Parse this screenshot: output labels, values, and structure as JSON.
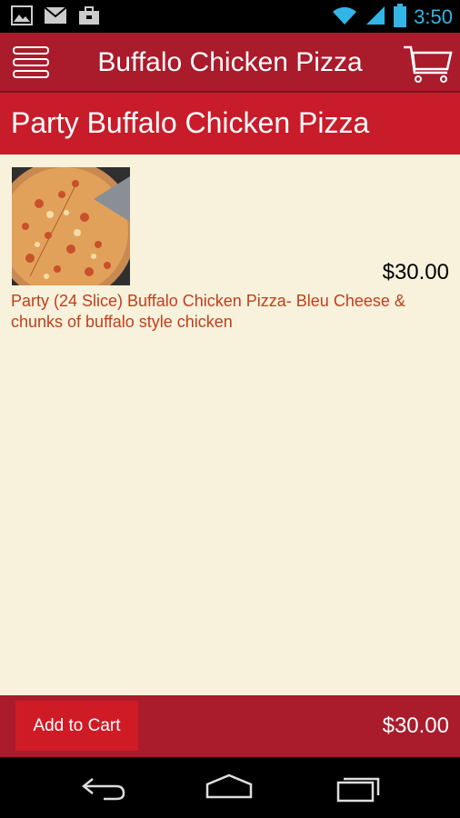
{
  "status_bar": {
    "time": "3:50",
    "icons": [
      "image-icon",
      "gmail-icon",
      "briefcase-icon",
      "wifi-icon",
      "signal-icon",
      "battery-icon"
    ]
  },
  "app_bar": {
    "title": "Buffalo Chicken Pizza",
    "menu_icon": "menu-icon",
    "cart_icon": "cart-icon"
  },
  "section": {
    "title": "Party Buffalo Chicken Pizza"
  },
  "item": {
    "price": "$30.00",
    "description": "Party (24 Slice) Buffalo Chicken Pizza- Bleu Cheese & chunks of buffalo style chicken",
    "image": "pizza-photo"
  },
  "bottom_bar": {
    "add_to_cart_label": "Add to Cart",
    "total": "$30.00"
  },
  "nav_bar": {
    "icons": [
      "back-icon",
      "home-icon",
      "recents-icon"
    ]
  },
  "colors": {
    "app_bar": "#aa1b2b",
    "section_header": "#c81c2a",
    "content_bg": "#f8f1dc",
    "description_text": "#c0401c",
    "button": "#cf1b26"
  }
}
